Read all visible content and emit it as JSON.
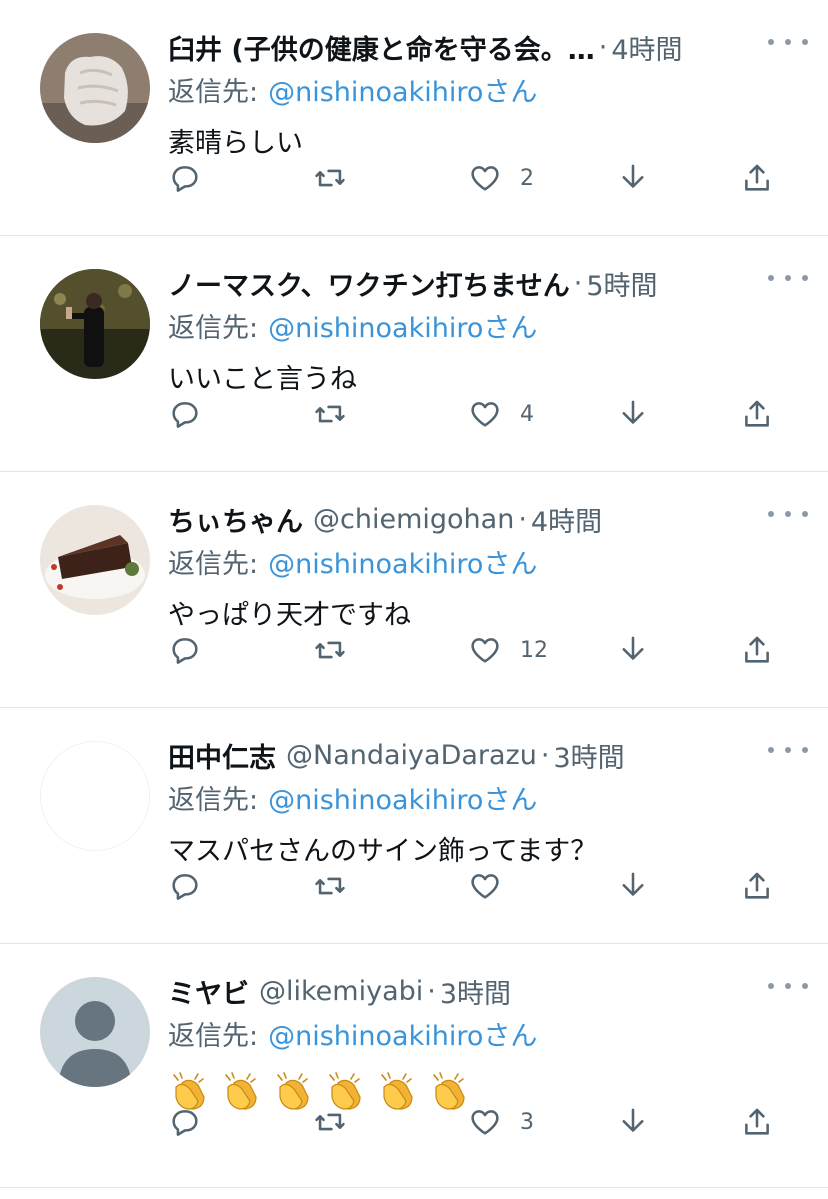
{
  "reply_prefix": "返信先:",
  "reply_mention": "@nishinoakihiro",
  "reply_suffix": "さん",
  "colors": {
    "mention": "#3b94d9",
    "secondary": "#536471",
    "divider": "#e1e6ea",
    "icon": "#536471"
  },
  "icons": {
    "reply": "reply-icon",
    "retweet": "retweet-icon",
    "like": "heart-icon",
    "download": "download-icon",
    "share": "share-icon",
    "more": "more-icon"
  },
  "tweets": [
    {
      "name": "臼井 (子供の健康と命を守る会。…",
      "handle": "",
      "time": "4時間",
      "text": "素晴らしい",
      "likes": "2"
    },
    {
      "name": "ノーマスク、ワクチン打ちません",
      "handle": "",
      "time": "5時間",
      "text": "いいこと言うね",
      "likes": "4"
    },
    {
      "name": "ちぃちゃん",
      "handle": "@chiemigohan",
      "time": "4時間",
      "text": "やっぱり天才ですね",
      "likes": "12"
    },
    {
      "name": "田中仁志",
      "handle": "@NandaiyaDarazu",
      "time": "3時間",
      "text": "マスパセさんのサイン飾ってます？",
      "likes": ""
    },
    {
      "name": "ミヤビ",
      "handle": "@likemiyabi",
      "time": "3時間",
      "text": "",
      "emoji": [
        "👏",
        "👏",
        "👏",
        "👏",
        "👏",
        "👏"
      ],
      "likes": "3"
    }
  ]
}
